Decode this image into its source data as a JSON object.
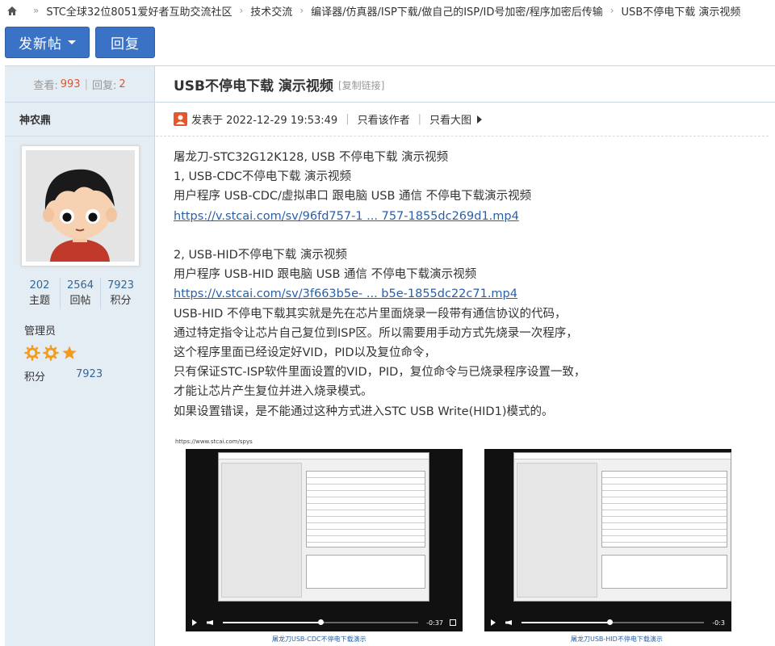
{
  "breadcrumb": {
    "items": [
      "STC全球32位8051爱好者互助交流社区",
      "技术交流",
      "编译器/仿真器/ISP下载/做自己的ISP/ID号加密/程序加密后传输",
      "USB不停电下载 演示视频"
    ]
  },
  "toolbar": {
    "post_label": "发新帖",
    "reply_label": "回复"
  },
  "thread": {
    "views_label": "查看:",
    "views": "993",
    "pipe": "|",
    "replies_label": "回复:",
    "replies": "2",
    "title": "USB不停电下载 演示视频",
    "copy_link": "[复制链接]"
  },
  "author": {
    "name": "神农鼎",
    "stats": [
      {
        "value": "202",
        "label": "主题"
      },
      {
        "value": "2564",
        "label": "回帖"
      },
      {
        "value": "7923",
        "label": "积分"
      }
    ],
    "role": "管理员",
    "credits_label": "积分",
    "credits": "7923"
  },
  "post": {
    "posted_at": "发表于 2022-12-29 19:53:49",
    "only_author": "只看该作者",
    "big_image": "只看大图",
    "lines": [
      "屠龙刀-STC32G12K128, USB 不停电下载 演示视频",
      "1, USB-CDC不停电下载 演示视频",
      "用户程序 USB-CDC/虚拟串口 跟电脑 USB 通信 不停电下载演示视频"
    ],
    "link1": "https://v.stcai.com/sv/96fd757-1 ... 757-1855dc269d1.mp4",
    "lines2": [
      "2, USB-HID不停电下载 演示视频",
      "用户程序 USB-HID 跟电脑 USB 通信 不停电下载演示视频"
    ],
    "link2": "https://v.stcai.com/sv/3f663b5e- ... b5e-1855dc22c71.mp4",
    "lines3": [
      "USB-HID 不停电下载其实就是先在芯片里面烧录一段带有通信协议的代码，",
      "通过特定指令让芯片自己复位到ISP区。所以需要用手动方式先烧录一次程序，",
      "这个程序里面已经设定好VID，PID以及复位命令，",
      "只有保证STC-ISP软件里面设置的VID，PID，复位命令与已烧录程序设置一致，",
      "才能让芯片产生复位并进入烧录模式。",
      "如果设置错误，是不能通过这种方式进入STC USB Write(HID1)模式的。"
    ]
  },
  "screenshot": {
    "url": "https://www.stcai.com/spys",
    "video1": {
      "time": "-0:37",
      "progress": 0.5,
      "caption": "屠龙刀USB-CDC不停电下载演示"
    },
    "video2": {
      "time": "-0:3",
      "progress": 0.48,
      "caption": "屠龙刀USB-HID不停电下载演示"
    }
  },
  "colors": {
    "accent": "#3a72c6",
    "sidebar_bg": "#e5edf4",
    "link": "#2a5fa6",
    "count": "#e2542a",
    "star": "#f29b1e"
  }
}
